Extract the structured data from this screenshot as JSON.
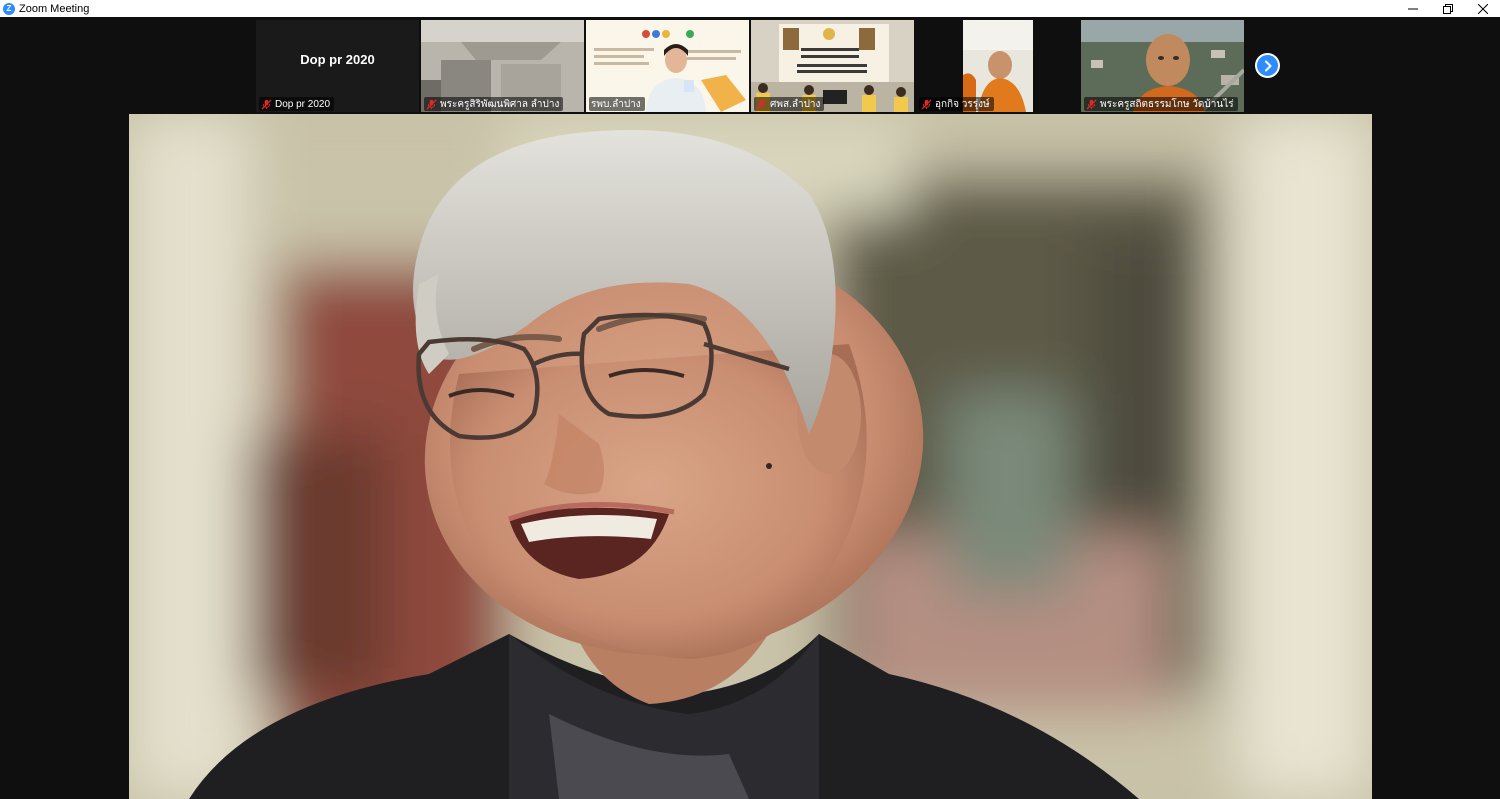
{
  "window": {
    "title": "Zoom Meeting",
    "app_icon_letter": "Z"
  },
  "participants": [
    {
      "name": "Dop pr 2020",
      "display_name": "Dop pr 2020",
      "muted": true,
      "video": false
    },
    {
      "name": "พระครูสิริพัฒนพิศาล ลำปาง",
      "muted": true,
      "video": true
    },
    {
      "name": "รพบ.ลำปาง",
      "muted": true,
      "video": true
    },
    {
      "name": "ศพส.ลำปาง",
      "muted": true,
      "video": true
    },
    {
      "name": "อุกกิจ วรรุ่งษ์",
      "muted": true,
      "video": true
    },
    {
      "name": "พระครูสถิตธรรมโกษ วัดบ้านไร่",
      "muted": true,
      "video": true
    }
  ],
  "colors": {
    "zoom_blue": "#2D8CFF",
    "mute_red": "#E02828",
    "background": "#0f0f0f"
  },
  "icons": {
    "next_page": "chevron-right-icon",
    "mute": "muted-mic-icon"
  }
}
